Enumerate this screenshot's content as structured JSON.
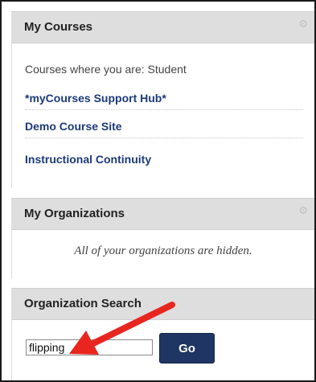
{
  "my_courses": {
    "title": "My Courses",
    "role_text": "Courses where you are: Student",
    "courses": [
      {
        "label": "*myCourses Support Hub*"
      },
      {
        "label": "Demo Course Site"
      },
      {
        "label": "Instructional Continuity"
      }
    ]
  },
  "my_organizations": {
    "title": "My Organizations",
    "empty_message": "All of your organizations are hidden."
  },
  "organization_search": {
    "title": "Organization Search",
    "input_value": "flipping",
    "go_label": "Go"
  },
  "icons": {
    "module_settings": "gear-icon",
    "annotation": "red-arrow-icon"
  },
  "colors": {
    "header_bg": "#dedede",
    "link": "#1c3a7a",
    "button_bg": "#1f3563",
    "arrow": "#e8261f"
  }
}
